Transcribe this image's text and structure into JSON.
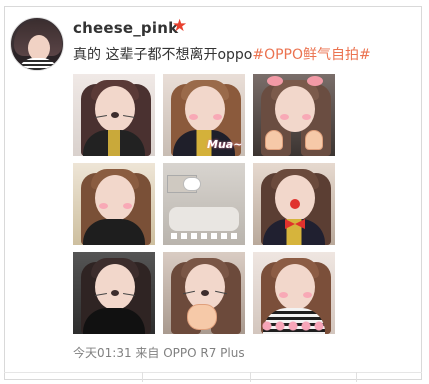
{
  "post": {
    "username": "cheese_pink",
    "vip_icon": "★",
    "text_prefix": "真的 这辈子都不想离开oppo",
    "hashtag": "#OPPO鲜气自拍#",
    "meta": "今天01:31 来自 OPPO R7 Plus"
  },
  "photos": [
    {
      "name": "photo-1",
      "kind": "cat-filter"
    },
    {
      "name": "photo-2",
      "kind": "mua-graduation"
    },
    {
      "name": "photo-3",
      "kind": "hands-under-chin"
    },
    {
      "name": "photo-4",
      "kind": "blush-selfie"
    },
    {
      "name": "photo-5",
      "kind": "room-stickers"
    },
    {
      "name": "photo-6",
      "kind": "red-nose-bow"
    },
    {
      "name": "photo-7",
      "kind": "cat-filter-dark"
    },
    {
      "name": "photo-8",
      "kind": "cat-whiskers"
    },
    {
      "name": "photo-9",
      "kind": "striped-top-hearts"
    }
  ],
  "colors": {
    "text": "#333333",
    "hashtag": "#eb7350",
    "meta": "#808080",
    "vip": "#e8402e",
    "border": "#d9d9d9"
  }
}
